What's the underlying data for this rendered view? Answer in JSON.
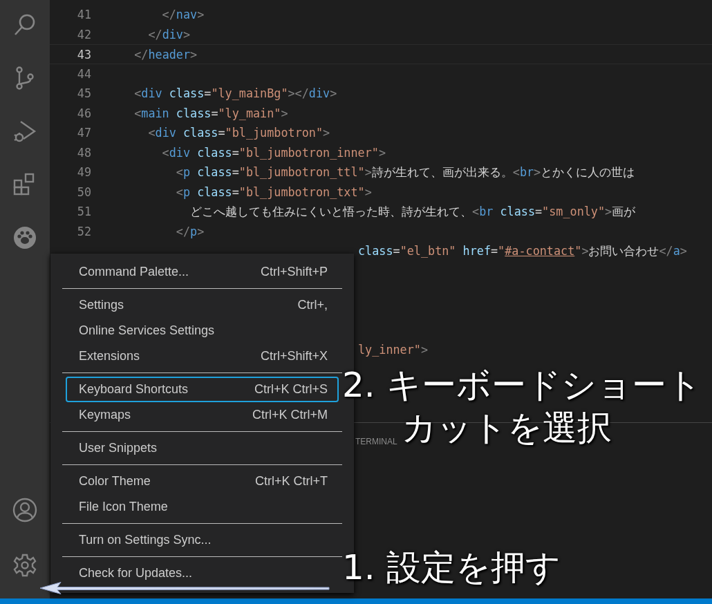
{
  "activity_bar": {
    "top_icons": [
      {
        "kind": "search"
      },
      {
        "kind": "source-control"
      },
      {
        "kind": "run-debug"
      },
      {
        "kind": "extensions"
      },
      {
        "kind": "paw"
      }
    ],
    "bottom_icons": [
      {
        "kind": "account"
      },
      {
        "kind": "settings"
      }
    ]
  },
  "editor": {
    "lines": [
      {
        "kind": "full",
        "number": "41",
        "current": false,
        "tokens": [
          {
            "kind": "p",
            "s": "      </"
          },
          {
            "kind": "tag",
            "s": "nav"
          },
          {
            "kind": "p",
            "s": ">"
          }
        ]
      },
      {
        "kind": "full",
        "number": "42",
        "current": false,
        "tokens": [
          {
            "kind": "p",
            "s": "    </"
          },
          {
            "kind": "tag",
            "s": "div"
          },
          {
            "kind": "p",
            "s": ">"
          }
        ]
      },
      {
        "kind": "full",
        "number": "43",
        "current": true,
        "tokens": [
          {
            "kind": "p",
            "s": "  </"
          },
          {
            "kind": "tag",
            "s": "header"
          },
          {
            "kind": "p",
            "s": ">"
          }
        ]
      },
      {
        "kind": "full",
        "number": "44",
        "current": false
      },
      {
        "kind": "full",
        "number": "45",
        "current": false,
        "tokens": [
          {
            "kind": "p",
            "s": "  <"
          },
          {
            "kind": "tag",
            "s": "div "
          },
          {
            "kind": "attr",
            "s": "class"
          },
          {
            "kind": "text",
            "s": "="
          },
          {
            "kind": "str",
            "s": "\"ly_mainBg\""
          },
          {
            "kind": "p",
            "s": "></"
          },
          {
            "kind": "tag",
            "s": "div"
          },
          {
            "kind": "p",
            "s": ">"
          }
        ]
      },
      {
        "kind": "full",
        "number": "46",
        "current": false,
        "tokens": [
          {
            "kind": "p",
            "s": "  <"
          },
          {
            "kind": "tag",
            "s": "main "
          },
          {
            "kind": "attr",
            "s": "class"
          },
          {
            "kind": "text",
            "s": "="
          },
          {
            "kind": "str",
            "s": "\"ly_main\""
          },
          {
            "kind": "p",
            "s": ">"
          }
        ]
      },
      {
        "kind": "full",
        "number": "47",
        "current": false,
        "tokens": [
          {
            "kind": "p",
            "s": "    <"
          },
          {
            "kind": "tag",
            "s": "div "
          },
          {
            "kind": "attr",
            "s": "class"
          },
          {
            "kind": "text",
            "s": "="
          },
          {
            "kind": "str",
            "s": "\"bl_jumbotron\""
          },
          {
            "kind": "p",
            "s": ">"
          }
        ]
      },
      {
        "kind": "full",
        "number": "48",
        "current": false,
        "tokens": [
          {
            "kind": "p",
            "s": "      <"
          },
          {
            "kind": "tag",
            "s": "div "
          },
          {
            "kind": "attr",
            "s": "class"
          },
          {
            "kind": "text",
            "s": "="
          },
          {
            "kind": "str",
            "s": "\"bl_jumbotron_inner\""
          },
          {
            "kind": "p",
            "s": ">"
          }
        ]
      },
      {
        "kind": "full",
        "number": "49",
        "current": false,
        "tokens": [
          {
            "kind": "p",
            "s": "        <"
          },
          {
            "kind": "tag",
            "s": "p "
          },
          {
            "kind": "attr",
            "s": "class"
          },
          {
            "kind": "text",
            "s": "="
          },
          {
            "kind": "str",
            "s": "\"bl_jumbotron_ttl\""
          },
          {
            "kind": "p",
            "s": ">"
          },
          {
            "kind": "text",
            "s": "詩が生れて、画が出来る。"
          },
          {
            "kind": "p",
            "s": "<"
          },
          {
            "kind": "tag",
            "s": "br"
          },
          {
            "kind": "p",
            "s": ">"
          },
          {
            "kind": "text",
            "s": "とかくに人の世は"
          }
        ]
      },
      {
        "kind": "full",
        "number": "50",
        "current": false,
        "tokens": [
          {
            "kind": "p",
            "s": "        <"
          },
          {
            "kind": "tag",
            "s": "p "
          },
          {
            "kind": "attr",
            "s": "class"
          },
          {
            "kind": "text",
            "s": "="
          },
          {
            "kind": "str",
            "s": "\"bl_jumbotron_txt\""
          },
          {
            "kind": "p",
            "s": ">"
          }
        ]
      },
      {
        "kind": "full",
        "number": "51",
        "current": false,
        "tokens": [
          {
            "kind": "text",
            "s": "          どこへ越しても住みにくいと悟った時、詩が生れて、"
          },
          {
            "kind": "p",
            "s": "<"
          },
          {
            "kind": "tag",
            "s": "br "
          },
          {
            "kind": "attr",
            "s": "class"
          },
          {
            "kind": "text",
            "s": "="
          },
          {
            "kind": "str",
            "s": "\"sm_only\""
          },
          {
            "kind": "p",
            "s": ">"
          },
          {
            "kind": "text",
            "s": "画が"
          }
        ]
      },
      {
        "kind": "full",
        "number": "52",
        "current": false,
        "tokens": [
          {
            "kind": "p",
            "s": "        </"
          },
          {
            "kind": "tag",
            "s": "p"
          },
          {
            "kind": "p",
            "s": ">"
          }
        ]
      },
      {
        "kind": "partial",
        "tokens": [
          {
            "kind": "attr",
            "s": "class"
          },
          {
            "kind": "text",
            "s": "="
          },
          {
            "kind": "str",
            "s": "\"el_btn\" "
          },
          {
            "kind": "attr",
            "s": "href"
          },
          {
            "kind": "text",
            "s": "="
          },
          {
            "kind": "str",
            "s": "\""
          },
          {
            "kind": "link",
            "s": "#a-contact"
          },
          {
            "kind": "str",
            "s": "\""
          },
          {
            "kind": "p",
            "s": ">"
          },
          {
            "kind": "text",
            "s": "お問い合わせ"
          },
          {
            "kind": "p",
            "s": "</"
          },
          {
            "kind": "tag",
            "s": "a"
          },
          {
            "kind": "p",
            "s": ">"
          }
        ]
      },
      {
        "kind": "partial",
        "tokens": [
          {
            "kind": "str",
            "s": "ly_inner\""
          },
          {
            "kind": "p",
            "s": ">"
          }
        ]
      }
    ]
  },
  "panel": {
    "tab": "TERMINAL"
  },
  "menu": {
    "groups": [
      [
        {
          "label": "Command Palette...",
          "shortcut": "Ctrl+Shift+P",
          "selected": false
        }
      ],
      [
        {
          "label": "Settings",
          "shortcut": "Ctrl+,",
          "selected": false
        },
        {
          "label": "Online Services Settings",
          "selected": false
        },
        {
          "label": "Extensions",
          "shortcut": "Ctrl+Shift+X",
          "selected": false
        }
      ],
      [
        {
          "label": "Keyboard Shortcuts",
          "shortcut": "Ctrl+K Ctrl+S",
          "selected": true
        },
        {
          "label": "Keymaps",
          "shortcut": "Ctrl+K Ctrl+M",
          "selected": false
        }
      ],
      [
        {
          "label": "User Snippets",
          "selected": false
        }
      ],
      [
        {
          "label": "Color Theme",
          "shortcut": "Ctrl+K Ctrl+T",
          "selected": false
        },
        {
          "label": "File Icon Theme",
          "selected": false
        }
      ],
      [
        {
          "label": "Turn on Settings Sync...",
          "selected": false
        }
      ],
      [
        {
          "label": "Check for Updates...",
          "selected": false
        }
      ]
    ]
  },
  "annotations": {
    "step2": [
      "2. キーボードショート",
      "カットを選択"
    ],
    "step1": "1. 設定を押す"
  }
}
